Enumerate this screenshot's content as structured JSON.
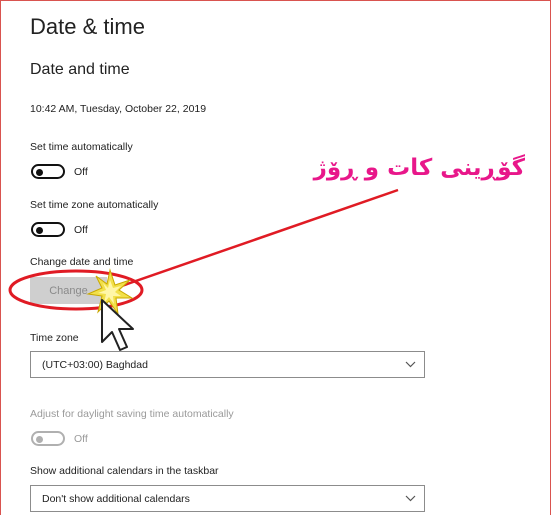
{
  "page_title": "Date & time",
  "section_title": "Date and time",
  "current_datetime": "10:42 AM, Tuesday, October 22, 2019",
  "set_time_auto": {
    "label": "Set time automatically",
    "state": "Off"
  },
  "set_timezone_auto": {
    "label": "Set time zone automatically",
    "state": "Off"
  },
  "change_date_time": {
    "label": "Change date and time",
    "button": "Change"
  },
  "time_zone": {
    "label": "Time zone",
    "value": "(UTC+03:00) Baghdad"
  },
  "daylight_saving": {
    "label": "Adjust for daylight saving time automatically",
    "state": "Off"
  },
  "additional_calendars": {
    "label": "Show additional calendars in the taskbar",
    "value": "Don't show additional calendars"
  },
  "annotation": {
    "text": "گۆڕینی کات و ڕۆژ",
    "color": "#e8178a",
    "line_color": "#e01b24"
  },
  "icons": {
    "dropdown": "chevron-down-icon",
    "cursor": "mouse-pointer-icon",
    "spark": "click-spark-icon"
  }
}
